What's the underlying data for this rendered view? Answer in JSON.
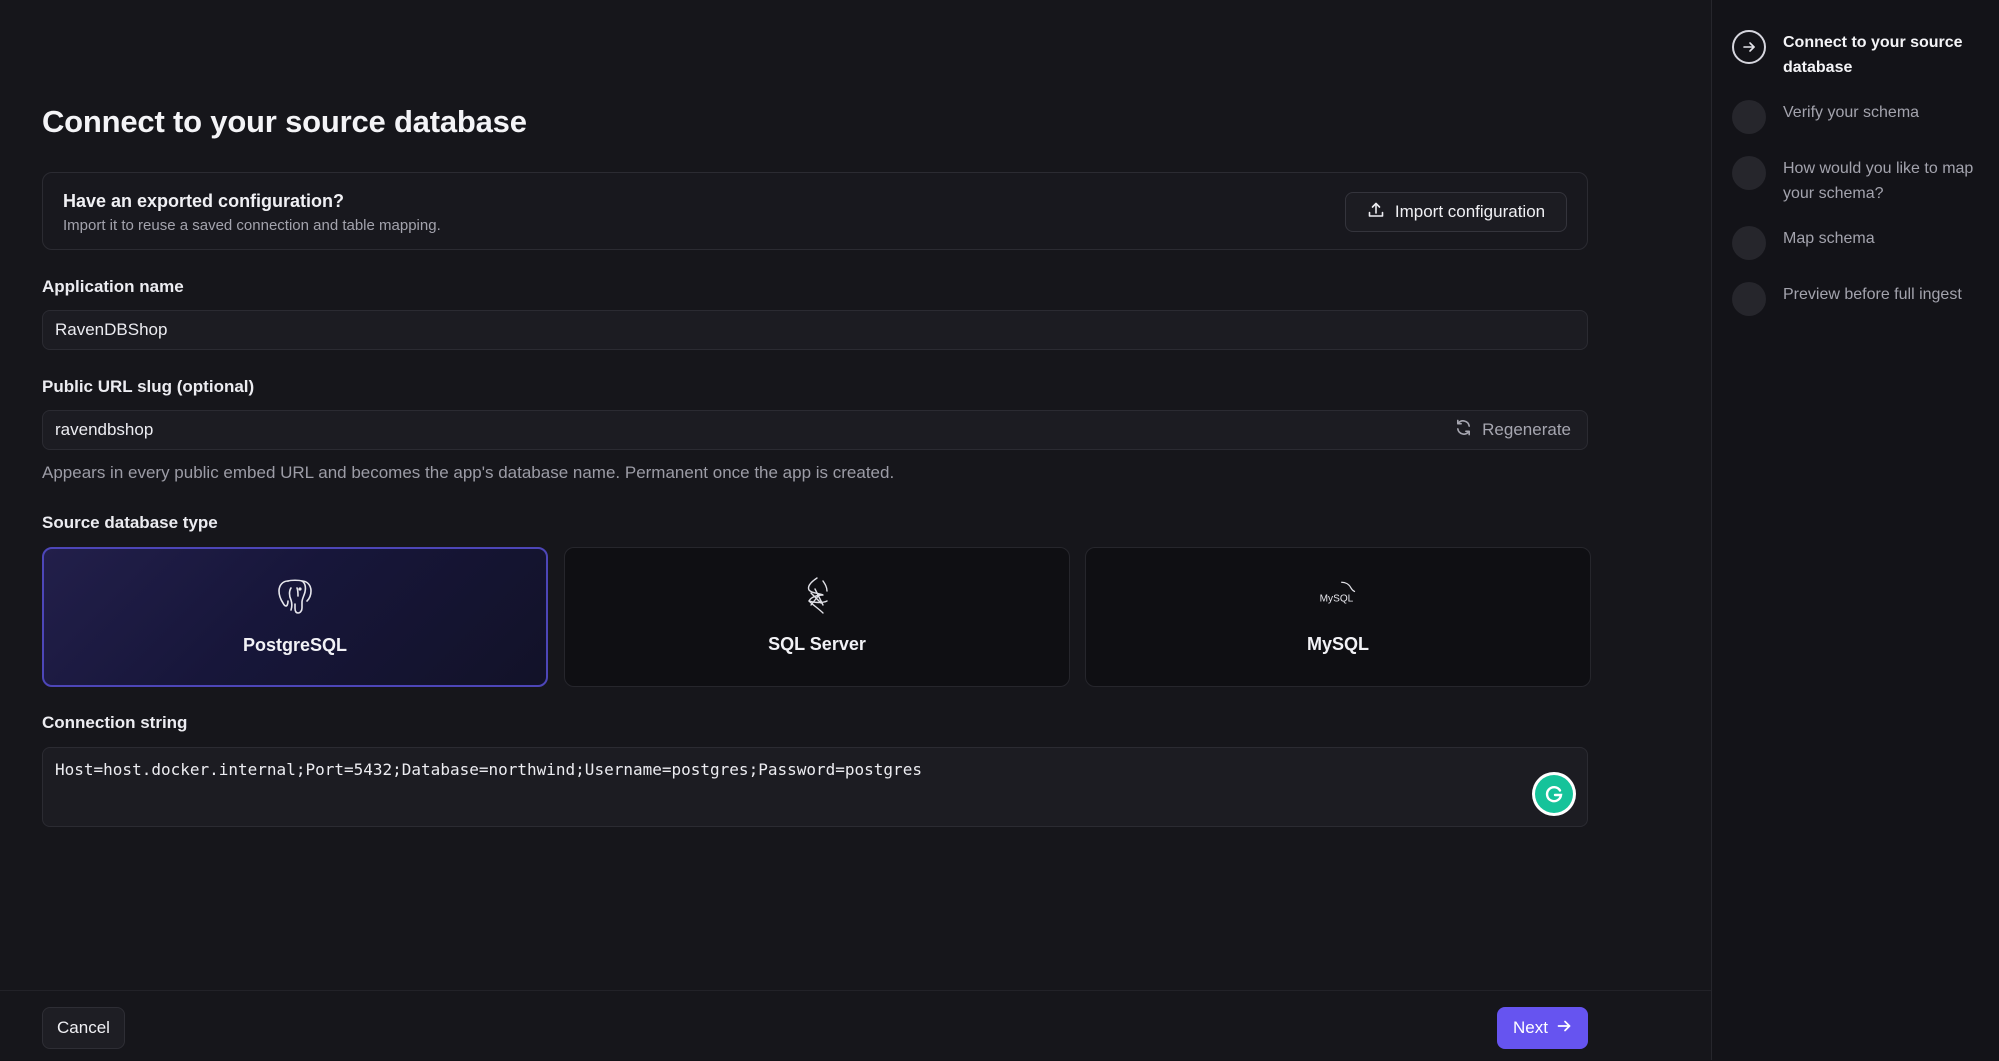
{
  "page": {
    "title": "Connect to your source database"
  },
  "import_card": {
    "title": "Have an exported configuration?",
    "subtitle": "Import it to reuse a saved connection and table mapping.",
    "button_label": "Import configuration",
    "button_icon": "upload-icon"
  },
  "app_name": {
    "label": "Application name",
    "value": "RavenDBShop"
  },
  "url_slug": {
    "label": "Public URL slug (optional)",
    "value": "ravendbshop",
    "regenerate_label": "Regenerate",
    "regenerate_icon": "refresh-icon",
    "hint": "Appears in every public embed URL and becomes the app's database name. Permanent once the app is created."
  },
  "db_type": {
    "label": "Source database type",
    "selected": "PostgreSQL",
    "options": [
      {
        "name": "PostgreSQL",
        "icon": "postgresql-elephant-icon"
      },
      {
        "name": "SQL Server",
        "icon": "sql-server-icon"
      },
      {
        "name": "MySQL",
        "icon": "mysql-logo-icon",
        "logo_text": "MySQL"
      }
    ]
  },
  "connection": {
    "label": "Connection string",
    "value": "Host=host.docker.internal;Port=5432;Database=northwind;Username=postgres;Password=postgres"
  },
  "footer": {
    "cancel_label": "Cancel",
    "next_label": "Next",
    "next_icon": "arrow-right-icon"
  },
  "steps": [
    {
      "label": "Connect to your source database",
      "active": true
    },
    {
      "label": "Verify your schema",
      "active": false
    },
    {
      "label": "How would you like to map your schema?",
      "active": false
    },
    {
      "label": "Map schema",
      "active": false
    },
    {
      "label": "Preview before full ingest",
      "active": false
    }
  ],
  "colors": {
    "accent": "#6654f0",
    "selected_border": "#4d46b8",
    "grammarly": "#15c39a"
  }
}
